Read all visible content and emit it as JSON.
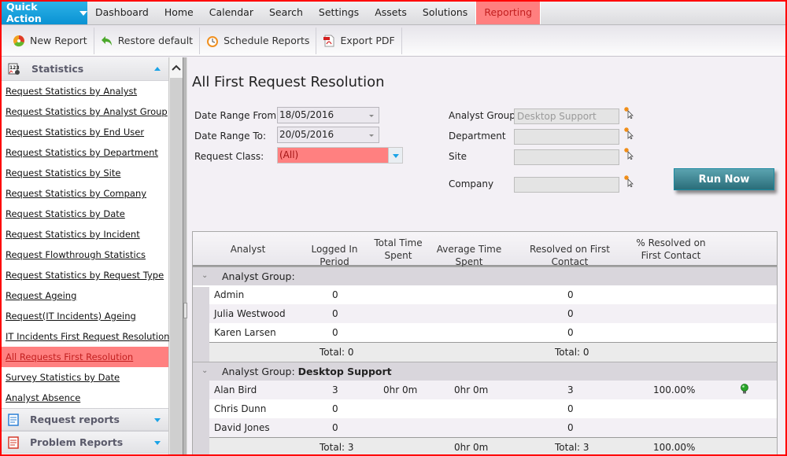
{
  "topnav": {
    "quick_action": "Quick Action",
    "items": [
      "Dashboard",
      "Home",
      "Calendar",
      "Search",
      "Settings",
      "Assets",
      "Solutions",
      "Reporting"
    ],
    "active": "Reporting"
  },
  "toolbar": {
    "new_report": "New Report",
    "restore_default": "Restore default",
    "schedule_reports": "Schedule Reports",
    "export_pdf": "Export PDF"
  },
  "sidebar": {
    "section_title": "Statistics",
    "items": [
      "Request Statistics by Analyst",
      "Request Statistics by Analyst Group",
      "Request Statistics by End User",
      "Request Statistics by Department",
      "Request Statistics by Site",
      "Request Statistics by Company",
      "Request Statistics by Date",
      "Request Statistics by Incident",
      "Request Flowthrough Statistics",
      "Request Statistics by Request Type",
      "Request Ageing",
      "Request(IT Incidents) Ageing",
      "IT Incidents First Request Resolution",
      "All Requests First Resolution",
      "Survey Statistics by Date",
      "Analyst Absence"
    ],
    "active_item": "All Requests First Resolution",
    "other_sections": [
      "Request reports",
      "Problem Reports"
    ]
  },
  "report": {
    "title": "All First Request Resolution",
    "date_from_label": "Date Range From:",
    "date_from": "18/05/2016",
    "date_to_label": "Date Range To:",
    "date_to": "20/05/2016",
    "request_class_label": "Request Class:",
    "request_class": "(All)",
    "analyst_group_label": "Analyst Group",
    "analyst_group": "Desktop Support",
    "department_label": "Department",
    "department": "",
    "site_label": "Site",
    "site": "",
    "company_label": "Company",
    "company": "",
    "run_now": "Run Now"
  },
  "grid": {
    "columns": [
      "Analyst",
      "Logged In Period",
      "Total Time Spent",
      "Average Time Spent",
      "Resolved on First Contact",
      "% Resolved on First Contact"
    ],
    "groups": [
      {
        "label": "Analyst Group:",
        "name": "",
        "rows": [
          {
            "analyst": "Admin",
            "logged": "0",
            "total_time": "",
            "avg_time": "",
            "resolved": "0",
            "pct": "",
            "indicator": false
          },
          {
            "analyst": "Julia Westwood",
            "logged": "0",
            "total_time": "",
            "avg_time": "",
            "resolved": "0",
            "pct": "",
            "indicator": false
          },
          {
            "analyst": "Karen Larsen",
            "logged": "0",
            "total_time": "",
            "avg_time": "",
            "resolved": "0",
            "pct": "",
            "indicator": false
          }
        ],
        "totals": {
          "logged": "Total: 0",
          "avg_time": "",
          "resolved": "Total: 0",
          "pct": ""
        }
      },
      {
        "label": "Analyst Group:",
        "name": "Desktop Support",
        "rows": [
          {
            "analyst": "Alan Bird",
            "logged": "3",
            "total_time": "0hr 0m",
            "avg_time": "0hr 0m",
            "resolved": "3",
            "pct": "100.00%",
            "indicator": true
          },
          {
            "analyst": "Chris Dunn",
            "logged": "0",
            "total_time": "",
            "avg_time": "",
            "resolved": "0",
            "pct": "",
            "indicator": false
          },
          {
            "analyst": "David Jones",
            "logged": "0",
            "total_time": "",
            "avg_time": "",
            "resolved": "0",
            "pct": "",
            "indicator": false
          }
        ],
        "totals": {
          "logged": "Total: 3",
          "avg_time": "0hr 0m",
          "resolved": "Total: 3",
          "pct": "100.00%"
        }
      }
    ]
  },
  "colors": {
    "quick_action": "#0a92d3",
    "highlight": "#ff8080",
    "run_button": "#2a6d79",
    "frame": "#ff0000"
  }
}
